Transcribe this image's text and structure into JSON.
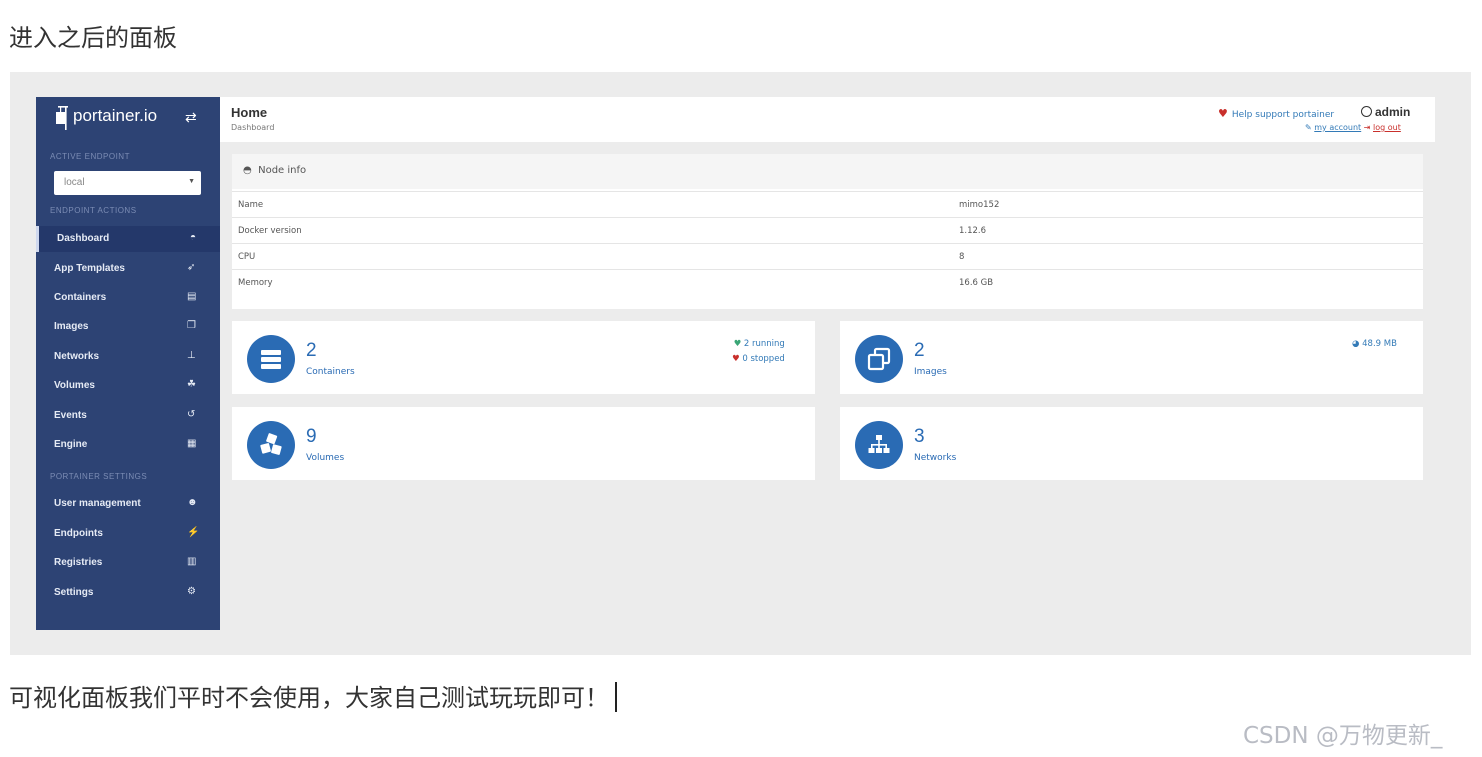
{
  "page": {
    "heading": "进入之后的面板",
    "caption": "可视化面板我们平时不会使用，大家自己测试玩玩即可！",
    "watermark": "CSDN @万物更新_"
  },
  "colors": {
    "sidebar": "#2d4374",
    "accent": "#2a6bb4",
    "link": "#337ab7",
    "danger": "#c9302c",
    "success": "#3aa676"
  },
  "sidebar": {
    "brand": "portainer.io",
    "active_endpoint_label": "ACTIVE ENDPOINT",
    "endpoint_value": "local",
    "endpoint_actions_label": "ENDPOINT ACTIONS",
    "items": [
      {
        "label": "Dashboard",
        "icon": "tachometer-icon"
      },
      {
        "label": "App Templates",
        "icon": "rocket-icon"
      },
      {
        "label": "Containers",
        "icon": "server-icon"
      },
      {
        "label": "Images",
        "icon": "clone-icon"
      },
      {
        "label": "Networks",
        "icon": "sitemap-icon"
      },
      {
        "label": "Volumes",
        "icon": "cubes-icon"
      },
      {
        "label": "Events",
        "icon": "history-icon"
      },
      {
        "label": "Engine",
        "icon": "th-icon"
      }
    ],
    "settings_label": "PORTAINER SETTINGS",
    "settings_items": [
      {
        "label": "User management",
        "icon": "users-icon"
      },
      {
        "label": "Endpoints",
        "icon": "plug-icon"
      },
      {
        "label": "Registries",
        "icon": "database-icon"
      },
      {
        "label": "Settings",
        "icon": "cogs-icon"
      }
    ]
  },
  "topbar": {
    "title": "Home",
    "breadcrumb": "Dashboard",
    "help": "Help support portainer",
    "user": "admin",
    "my_account": "my account",
    "log_out": "log out"
  },
  "node_info": {
    "title": "Node info",
    "rows": [
      {
        "key": "Name",
        "value": "mimo152"
      },
      {
        "key": "Docker version",
        "value": "1.12.6"
      },
      {
        "key": "CPU",
        "value": "8"
      },
      {
        "key": "Memory",
        "value": "16.6 GB"
      }
    ]
  },
  "tiles": {
    "containers": {
      "count": "2",
      "label": "Containers",
      "running": "2 running",
      "stopped": "0 stopped"
    },
    "images": {
      "count": "2",
      "label": "Images",
      "size": "48.9 MB"
    },
    "volumes": {
      "count": "9",
      "label": "Volumes"
    },
    "networks": {
      "count": "3",
      "label": "Networks"
    }
  }
}
